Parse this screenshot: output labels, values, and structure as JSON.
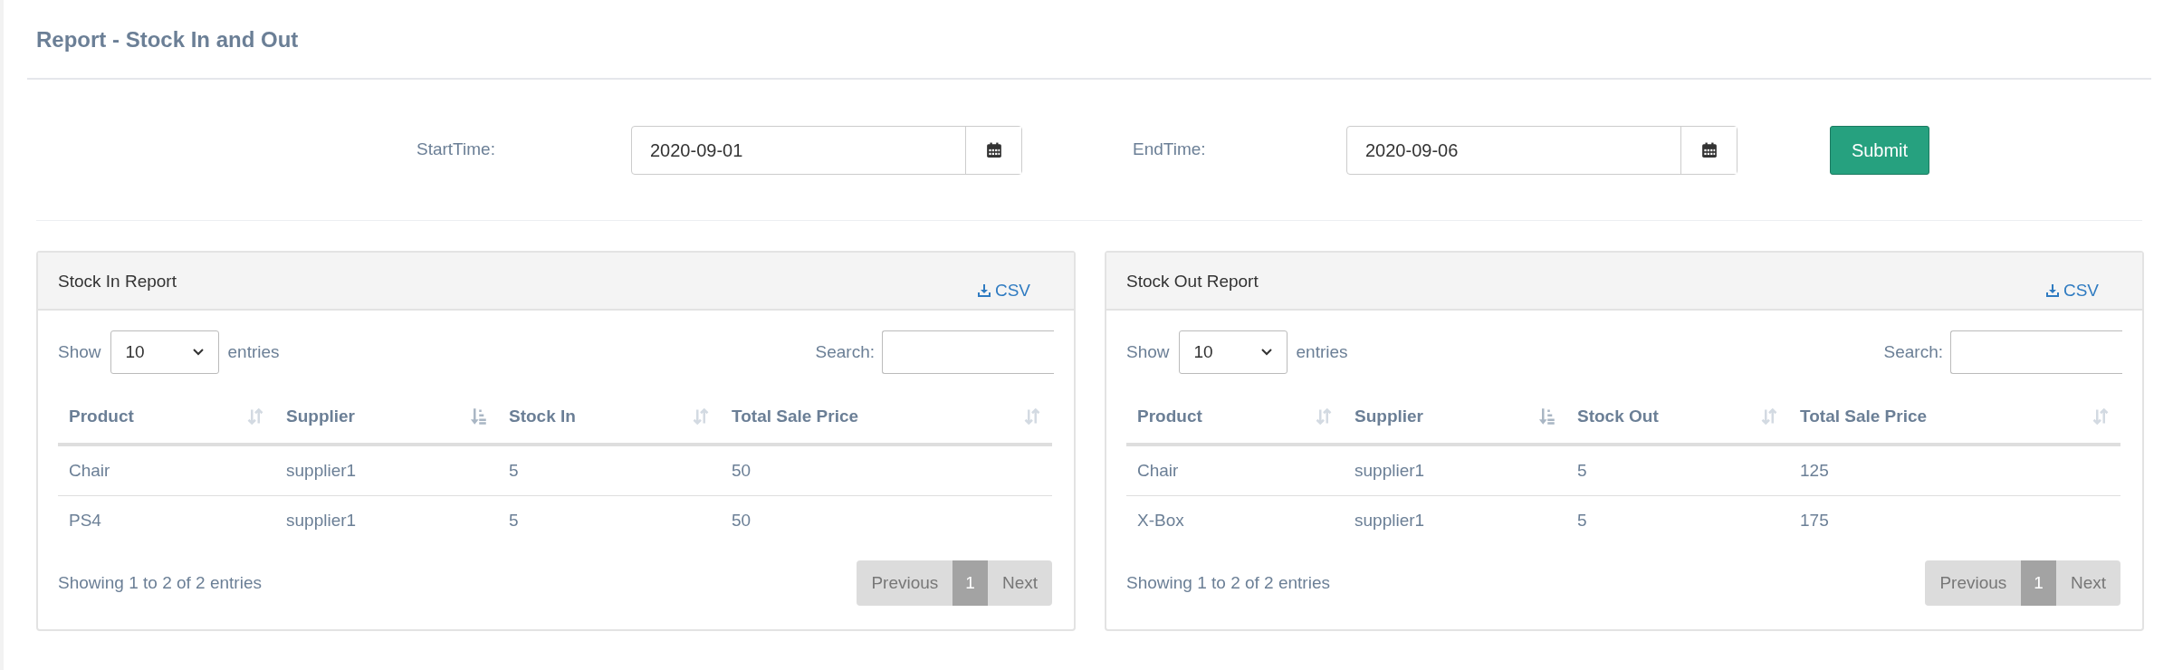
{
  "page_title": "Report - Stock In and Out",
  "filter": {
    "start_label": "StartTime:",
    "start_value": "2020-09-01",
    "end_label": "EndTime:",
    "end_value": "2020-09-06",
    "submit": "Submit"
  },
  "panels": [
    {
      "title": "Stock In Report",
      "csv": "CSV",
      "show_label": "Show",
      "page_size": "10",
      "entries_label": "entries",
      "search_label": "Search:",
      "columns": [
        {
          "label": "Product",
          "sorted": false
        },
        {
          "label": "Supplier",
          "sorted": true
        },
        {
          "label": "Stock In",
          "sorted": false
        },
        {
          "label": "Total Sale Price",
          "sorted": false
        }
      ],
      "rows": [
        [
          "Chair",
          "supplier1",
          "5",
          "50"
        ],
        [
          "PS4",
          "supplier1",
          "5",
          "50"
        ]
      ],
      "info": "Showing 1 to 2 of 2 entries",
      "pagination": {
        "previous": "Previous",
        "page": "1",
        "next": "Next"
      }
    },
    {
      "title": "Stock Out Report",
      "csv": "CSV",
      "show_label": "Show",
      "page_size": "10",
      "entries_label": "entries",
      "search_label": "Search:",
      "columns": [
        {
          "label": "Product",
          "sorted": false
        },
        {
          "label": "Supplier",
          "sorted": true
        },
        {
          "label": "Stock Out",
          "sorted": false
        },
        {
          "label": "Total Sale Price",
          "sorted": false
        }
      ],
      "rows": [
        [
          "Chair",
          "supplier1",
          "5",
          "125"
        ],
        [
          "X-Box",
          "supplier1",
          "5",
          "175"
        ]
      ],
      "info": "Showing 1 to 2 of 2 entries",
      "pagination": {
        "previous": "Previous",
        "page": "1",
        "next": "Next"
      }
    }
  ]
}
